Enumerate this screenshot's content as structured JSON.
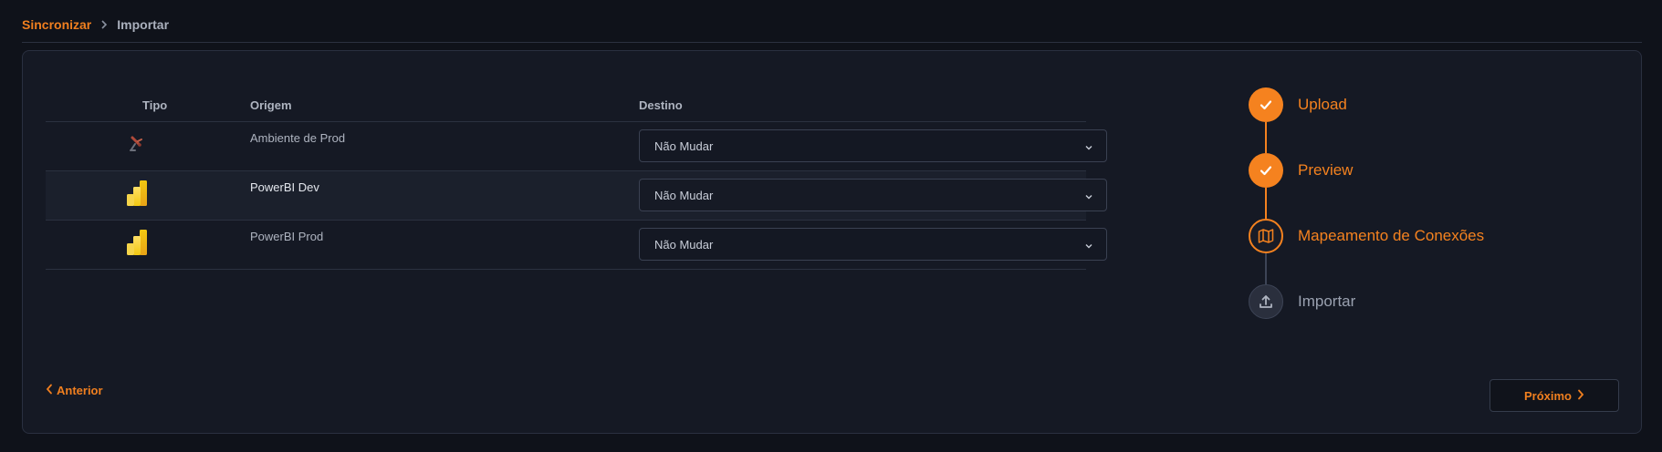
{
  "breadcrumb": {
    "parent": "Sincronizar",
    "current": "Importar"
  },
  "table": {
    "headers": {
      "tipo": "Tipo",
      "origem": "Origem",
      "destino": "Destino"
    },
    "rows": [
      {
        "icon": "satellite-dish-icon",
        "origem": "Ambiente de Prod",
        "destino": "Não Mudar"
      },
      {
        "icon": "powerbi-icon",
        "origem": "PowerBI Dev",
        "destino": "Não Mudar"
      },
      {
        "icon": "powerbi-icon",
        "origem": "PowerBI Prod",
        "destino": "Não Mudar"
      }
    ]
  },
  "stepper": {
    "steps": [
      {
        "label": "Upload",
        "state": "done",
        "icon": "check-icon"
      },
      {
        "label": "Preview",
        "state": "done",
        "icon": "check-icon"
      },
      {
        "label": "Mapeamento de Conexões",
        "state": "active",
        "icon": "map-icon"
      },
      {
        "label": "Importar",
        "state": "pending",
        "icon": "upload-icon"
      }
    ]
  },
  "footer": {
    "prev_label": "Anterior",
    "next_label": "Próximo"
  },
  "colors": {
    "accent": "#f5821f",
    "background": "#0f121a",
    "card": "#151924"
  }
}
